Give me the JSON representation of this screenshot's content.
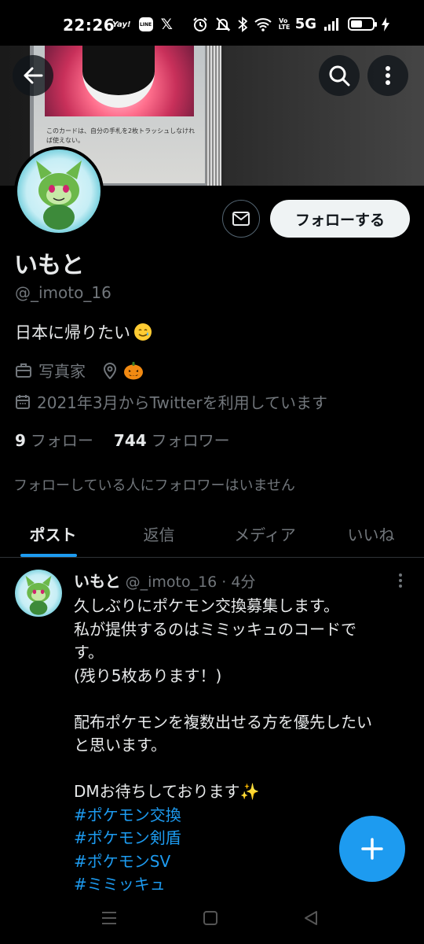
{
  "status_bar": {
    "time": "22:26",
    "yay_label": "Yay!",
    "line_label": "LINE",
    "x_label": "𝕏",
    "network": "5G",
    "volte": "Vo LTE",
    "battery_level": 0.55
  },
  "banner": {
    "card_text": "このカードは、自分の手札を2枚トラッシュしなければ使えない。"
  },
  "profile": {
    "name": "いもと",
    "handle": "@_imoto_16",
    "bio": "日本に帰りたい",
    "category": "写真家",
    "joined": "2021年3月からTwitterを利用しています",
    "following_count": "9",
    "following_label": "フォロー",
    "followers_count": "744",
    "followers_label": "フォロワー",
    "no_mutual_text": "フォローしている人にフォロワーはいません",
    "follow_button": "フォローする"
  },
  "tabs": [
    {
      "label": "ポスト",
      "active": true
    },
    {
      "label": "返信",
      "active": false
    },
    {
      "label": "メディア",
      "active": false
    },
    {
      "label": "いいね",
      "active": false
    }
  ],
  "tweet": {
    "name": "いもと",
    "handle": "@_imoto_16",
    "separator": "·",
    "time": "4分",
    "lines": [
      "久しぶりにポケモン交換募集します。",
      "私が提供するのはミミッキュのコードで",
      "す。",
      "(残り5枚あります！)",
      "",
      "配布ポケモンを複数出せる方を優先したい",
      "と思います。",
      "",
      "DMお待ちしております"
    ],
    "sparkle": "✨",
    "hashtags": [
      "#ポケモン交換",
      "#ポケモン剣盾",
      "#ポケモンSV",
      "#ミミッキュ"
    ]
  },
  "colors": {
    "accent": "#1d9bf0",
    "background": "#000000",
    "secondary_text": "#71767b",
    "primary_text": "#e7e9ea"
  },
  "icons": [
    "back-arrow-icon",
    "search-icon",
    "more-vertical-icon",
    "mail-icon",
    "briefcase-icon",
    "location-pin-icon",
    "pumpkin-emoji",
    "calendar-icon",
    "tear-smile-emoji",
    "compose-plus-icon",
    "nav-menu-icon",
    "nav-home-icon",
    "nav-back-icon"
  ]
}
